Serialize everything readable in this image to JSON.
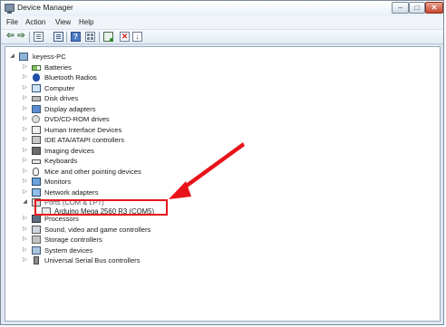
{
  "window": {
    "title": "Device Manager",
    "controls": {
      "minimize": "–",
      "maximize": "□",
      "close": "✕"
    }
  },
  "menu": [
    "File",
    "Action",
    "View",
    "Help"
  ],
  "toolbar": {
    "buttons": [
      "back-icon",
      "forward-icon",
      "view-icon",
      "properties-icon",
      "help-icon",
      "grid-icon",
      "update-driver-icon",
      "uninstall-icon",
      "disable-icon"
    ]
  },
  "tree": {
    "root": "keyess-PC",
    "items": [
      "Batteries",
      "Bluetooth Radios",
      "Computer",
      "Disk drives",
      "Display adapters",
      "DVD/CD-ROM drives",
      "Human Interface Devices",
      "IDE ATA/ATAPI controllers",
      "Imaging devices",
      "Keyboards",
      "Mice and other pointing devices",
      "Monitors",
      "Network adapters",
      "Ports (COM & LPT)",
      "Arduino Mega 2560 R3 (COM5)",
      "Processors",
      "Sound, video and game controllers",
      "Storage controllers",
      "System devices",
      "Universal Serial Bus controllers"
    ]
  },
  "colors": {
    "highlight": "#e8131a",
    "accent": "#3a6ea5"
  }
}
